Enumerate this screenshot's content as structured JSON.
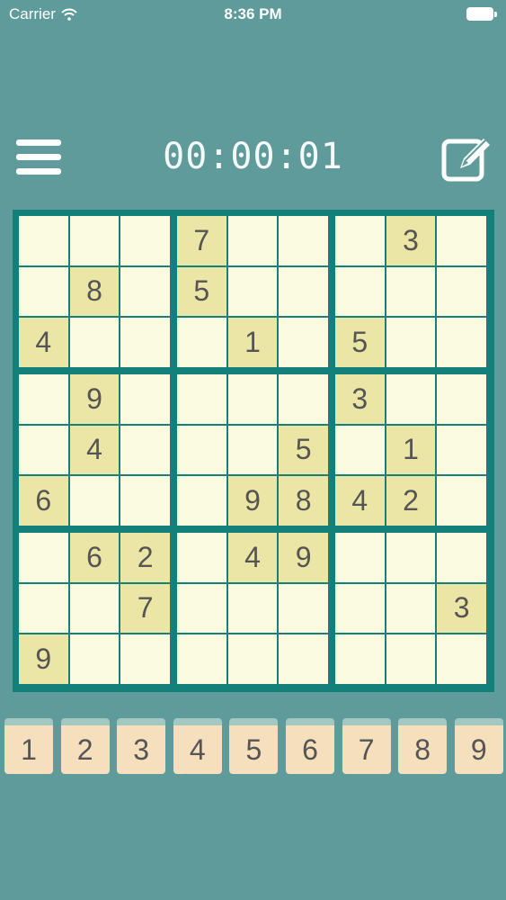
{
  "status_bar": {
    "carrier": "Carrier",
    "time": "8:36 PM"
  },
  "toolbar": {
    "timer": "00:00:01"
  },
  "colors": {
    "background": "#5f9b9b",
    "board_border": "#14807a",
    "cell": "#fbfbe2",
    "given_cell": "#ece6a6",
    "key": "#f6dfbd"
  },
  "icons": {
    "menu": "hamburger-icon",
    "edit": "edit-note-icon",
    "wifi": "wifi-icon",
    "battery": "battery-icon"
  },
  "board": {
    "grid": [
      [
        "",
        "",
        "",
        "7",
        "",
        "",
        "",
        "3",
        ""
      ],
      [
        "",
        "8",
        "",
        "5",
        "",
        "",
        "",
        "",
        ""
      ],
      [
        "4",
        "",
        "",
        "",
        "1",
        "",
        "5",
        "",
        ""
      ],
      [
        "",
        "9",
        "",
        "",
        "",
        "",
        "3",
        "",
        ""
      ],
      [
        "",
        "4",
        "",
        "",
        "",
        "5",
        "",
        "1",
        ""
      ],
      [
        "6",
        "",
        "",
        "",
        "9",
        "8",
        "4",
        "2",
        ""
      ],
      [
        "",
        "6",
        "2",
        "",
        "4",
        "9",
        "",
        "",
        ""
      ],
      [
        "",
        "",
        "7",
        "",
        "",
        "",
        "",
        "",
        "3"
      ],
      [
        "9",
        "",
        "",
        "",
        "",
        "",
        "",
        "",
        ""
      ]
    ]
  },
  "numpad": {
    "keys": [
      "1",
      "2",
      "3",
      "4",
      "5",
      "6",
      "7",
      "8",
      "9"
    ]
  }
}
